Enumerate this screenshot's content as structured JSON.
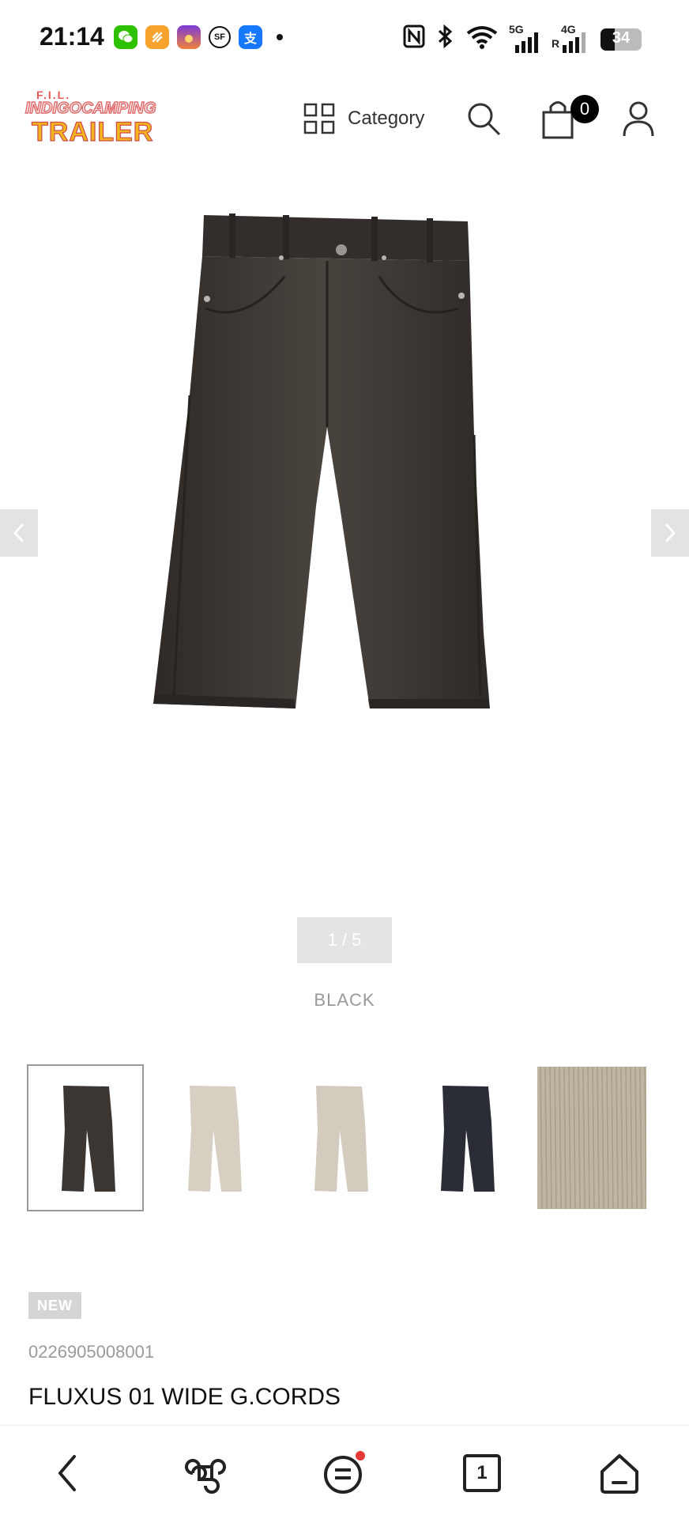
{
  "status_bar": {
    "time": "21:14",
    "app_icons": [
      {
        "name": "wechat-icon",
        "color": "#2dc100",
        "glyph": "◉"
      },
      {
        "name": "app-orange-icon",
        "color": "#f7a22c",
        "glyph": "◈"
      },
      {
        "name": "app-gallery-icon",
        "color": "#a35bd9",
        "glyph": "◐"
      },
      {
        "name": "sf-express-icon",
        "color": "#ffffff",
        "glyph": "SF"
      },
      {
        "name": "alipay-icon",
        "color": "#1677ff",
        "glyph": "支"
      }
    ],
    "network_5g": "5G",
    "network_4g": "4G",
    "battery_level": "34"
  },
  "header": {
    "logo_top": "F.I.L.",
    "logo_middle": "INDIGOCAMPING",
    "logo_bottom": "TRAILER",
    "category_label": "Category",
    "cart_count": "0"
  },
  "product": {
    "image_counter": "1 / 5",
    "color_name": "BLACK",
    "badge": "NEW",
    "sku": "0226905008001",
    "title": "FLUXUS 01 WIDE G.CORDS"
  },
  "thumbnails": [
    {
      "name": "thumb-black-pants",
      "color": "#3b3632",
      "type": "pants",
      "selected": true
    },
    {
      "name": "thumb-beige-pants-front",
      "color": "#d6cfc2",
      "type": "pants",
      "selected": false
    },
    {
      "name": "thumb-beige-pants-back",
      "color": "#d3cbbd",
      "type": "pants",
      "selected": false
    },
    {
      "name": "thumb-navy-pants",
      "color": "#2a2d35",
      "type": "pants",
      "selected": false
    },
    {
      "name": "thumb-fabric-swatch",
      "color": "#bfb5a3",
      "type": "swatch",
      "selected": false
    }
  ],
  "colors": {
    "accent_red": "#e53935",
    "pants_main": "#3a3531"
  }
}
